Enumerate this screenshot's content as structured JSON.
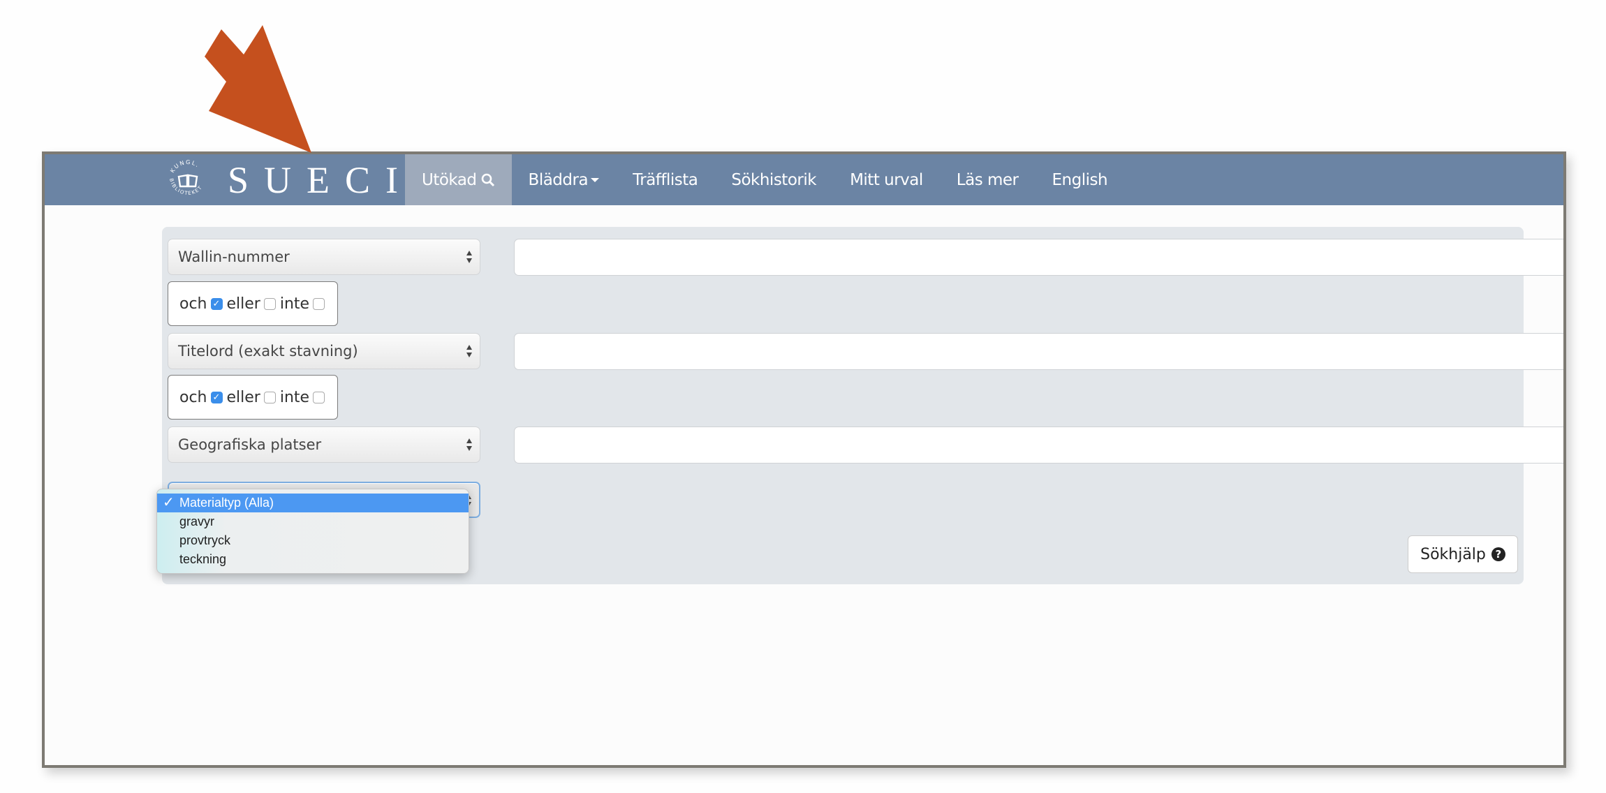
{
  "annotation": {
    "arrow_color": "#c5501e",
    "points_to": "nav.items.0"
  },
  "brand": {
    "seal_text_top": "KUNGL.",
    "seal_text_bottom": "BIBLIOTEKET",
    "wordmark": "SUECIA"
  },
  "colors": {
    "navbar": "#6b84a4",
    "nav_active": "#9eaabb",
    "panel": "#e2e6ea",
    "highlight": "#4c98f2"
  },
  "nav": {
    "items": [
      {
        "label": "Utökad",
        "icon": "search-icon",
        "active": true
      },
      {
        "label": "Bläddra",
        "icon": "caret-down-icon",
        "active": false
      },
      {
        "label": "Träfflista",
        "active": false
      },
      {
        "label": "Sökhistorik",
        "active": false
      },
      {
        "label": "Mitt urval",
        "active": false
      },
      {
        "label": "Läs mer",
        "active": false
      },
      {
        "label": "English",
        "active": false
      }
    ]
  },
  "search": {
    "rows": [
      {
        "field": "Wallin-nummer",
        "value": ""
      },
      {
        "field": "Titelord (exakt stavning)",
        "value": ""
      },
      {
        "field": "Geografiska platser",
        "value": ""
      }
    ],
    "operators": [
      {
        "och": "och",
        "eller": "eller",
        "inte": "inte",
        "och_checked": true,
        "eller_checked": false,
        "inte_checked": false
      },
      {
        "och": "och",
        "eller": "eller",
        "inte": "inte",
        "och_checked": true,
        "eller_checked": false,
        "inte_checked": false
      }
    ],
    "material_select": {
      "selected": "Materialtyp (Alla)",
      "options": [
        "Materialtyp (Alla)",
        "gravyr",
        "provtryck",
        "teckning"
      ]
    },
    "help_button": "Sökhjälp",
    "help_icon": "question-circle-icon"
  }
}
